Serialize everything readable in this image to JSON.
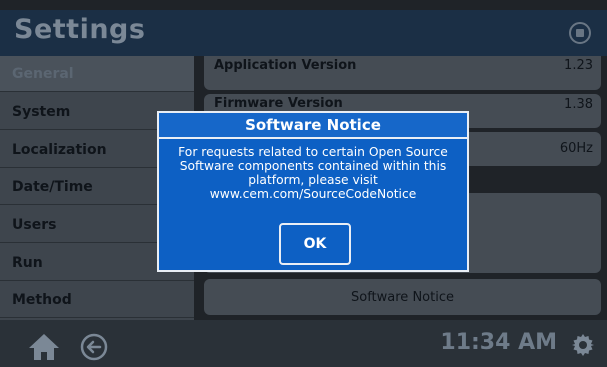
{
  "header": {
    "title": "Settings"
  },
  "sidebar": {
    "items": [
      {
        "label": "General"
      },
      {
        "label": "System"
      },
      {
        "label": "Localization"
      },
      {
        "label": "Date/Time"
      },
      {
        "label": "Users"
      },
      {
        "label": "Run"
      },
      {
        "label": "Method"
      }
    ]
  },
  "main": {
    "rows": [
      {
        "label": "Application Version",
        "value": "1.23"
      },
      {
        "label": "Firmware Version",
        "value": "1.38"
      },
      {
        "label": "",
        "value": "60Hz"
      }
    ],
    "software_notice_button": "Software Notice"
  },
  "dialog": {
    "title": "Software Notice",
    "message": "For requests related to certain Open Source Software components contained within this platform, please visit www.cem.com/SourceCodeNotice",
    "ok_label": "OK"
  },
  "footer": {
    "time": "11:34 AM"
  },
  "colors": {
    "dialog_bg": "#0d60c4",
    "header_bg": "#1b2f45",
    "sidebar_bg": "#3e454d"
  }
}
